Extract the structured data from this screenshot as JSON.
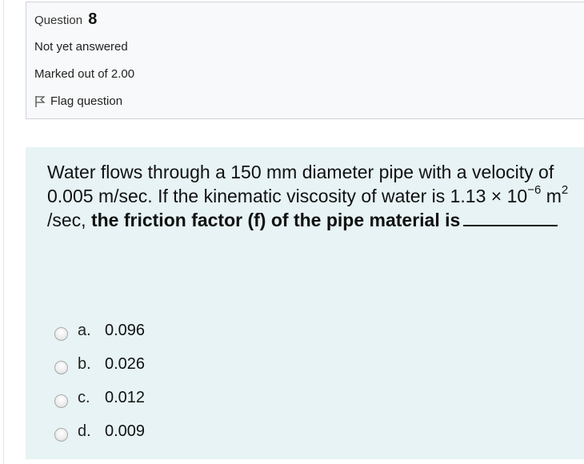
{
  "question_info": {
    "label": "Question",
    "number": "8",
    "state": "Not yet answered",
    "grade": "Marked out of 2.00",
    "flag_label": "Flag question"
  },
  "question": {
    "text_part1": "Water flows through a 150 mm diameter pipe with a velocity of 0.005 m/sec. If the kinematic viscosity of water is 1.13 × 10",
    "exp1": "−6",
    "text_part2": " m",
    "exp2": "2",
    "text_part3": " /sec, ",
    "bold_part": "the friction factor (f) of the pipe material is"
  },
  "options": [
    {
      "label": "a.",
      "value": "0.096"
    },
    {
      "label": "b.",
      "value": "0.026"
    },
    {
      "label": "c.",
      "value": "0.012"
    },
    {
      "label": "d.",
      "value": "0.009"
    }
  ],
  "colors": {
    "info_bg": "#f8f9fa",
    "question_bg": "#e7f3f5"
  }
}
